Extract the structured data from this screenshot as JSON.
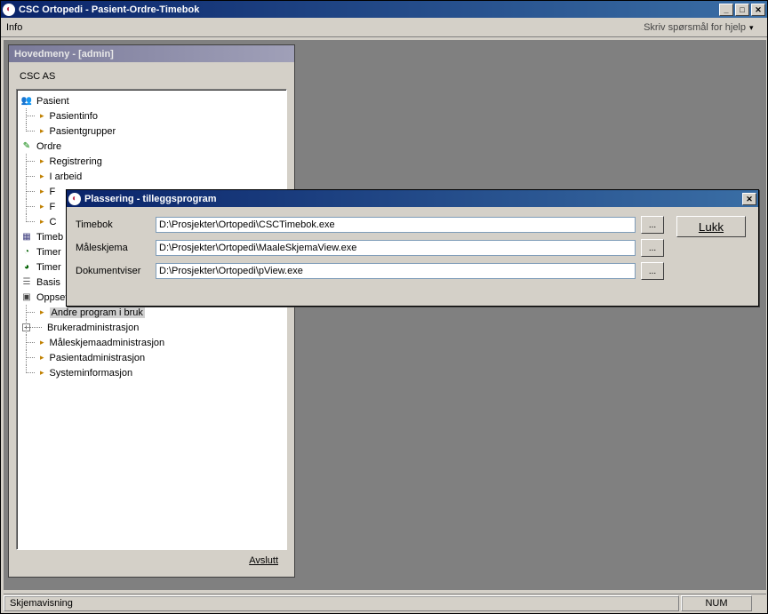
{
  "window": {
    "title": "CSC Ortopedi - Pasient-Ordre-Timebok",
    "min_btn": "_",
    "max_btn": "□",
    "close_btn": "✕"
  },
  "menubar": {
    "info": "Info",
    "help_placeholder": "Skriv spørsmål for hjelp"
  },
  "hovedmeny": {
    "title": "Hovedmeny - [admin]",
    "header": "CSC AS",
    "avslutt": "Avslutt",
    "nodes": {
      "pasient": "Pasient",
      "pasient_children": [
        "Pasientinfo",
        "Pasientgrupper"
      ],
      "ordre": "Ordre",
      "ordre_children": [
        "Registrering",
        "I arbeid",
        "F",
        "F",
        "C"
      ],
      "timeb": "Timeb",
      "timer1": "Timer",
      "timer2": "Timer",
      "basis": "Basis",
      "oppsett": "Oppsett",
      "oppsett_children": [
        "Andre program i bruk",
        "Brukeradministrasjon",
        "Måleskjemaadministrasjon",
        "Pasientadministrasjon",
        "Systeminformasjon"
      ]
    }
  },
  "dialog": {
    "title": "Plassering - tilleggsprogram",
    "close_btn": "✕",
    "lukk": "Lukk",
    "browse": "...",
    "rows": [
      {
        "label": "Timebok",
        "value": "D:\\Prosjekter\\Ortopedi\\CSCTimebok.exe"
      },
      {
        "label": "Måleskjema",
        "value": "D:\\Prosjekter\\Ortopedi\\MaaleSkjemaView.exe"
      },
      {
        "label": "Dokumentviser",
        "value": "D:\\Prosjekter\\Ortopedi\\pView.exe"
      }
    ]
  },
  "statusbar": {
    "left": "Skjemavisning",
    "right": "NUM"
  }
}
